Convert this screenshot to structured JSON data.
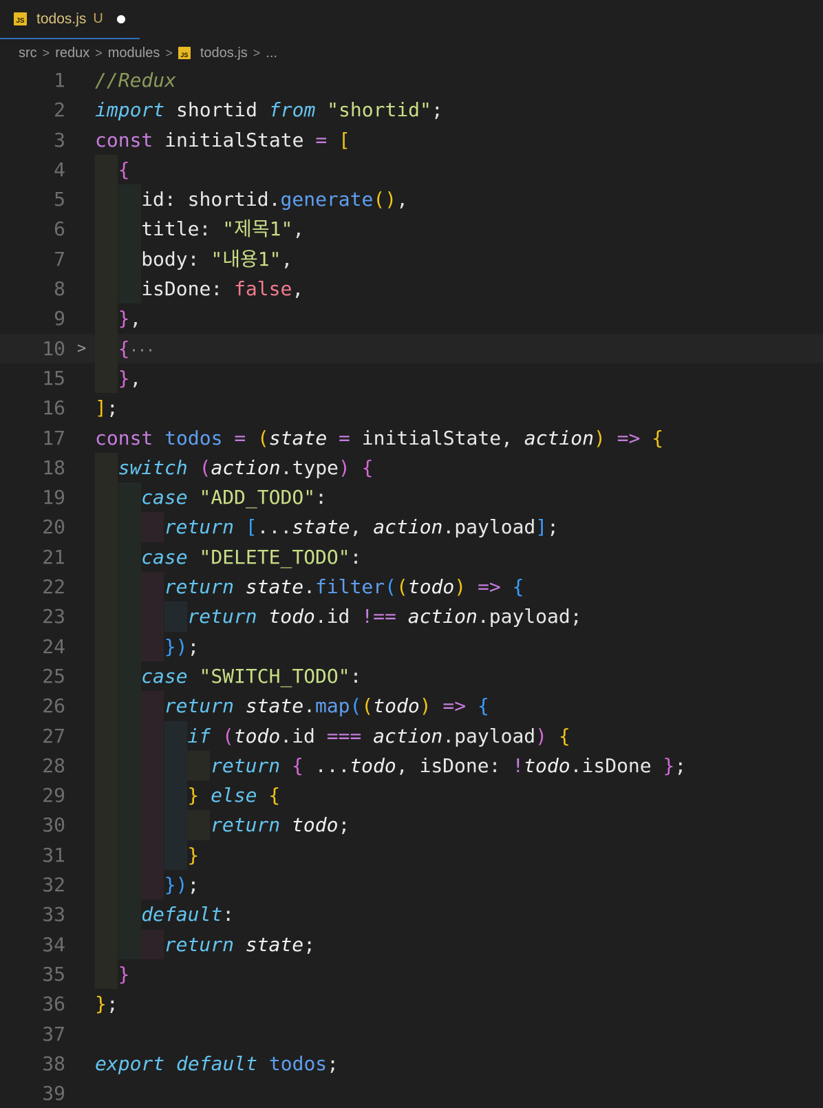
{
  "tab": {
    "icon": "js-file-icon",
    "icon_text": "JS",
    "filename": "todos.js",
    "status": "U"
  },
  "breadcrumb": {
    "parts": [
      "src",
      "redux",
      "modules",
      "todos.js",
      "..."
    ],
    "separator": ">"
  },
  "editor": {
    "lines": [
      {
        "n": "1",
        "indent": [],
        "tokens": [
          [
            "com",
            "//Redux"
          ]
        ]
      },
      {
        "n": "2",
        "indent": [],
        "tokens": [
          [
            "kwi",
            "import"
          ],
          [
            "var",
            " shortid "
          ],
          [
            "kwi",
            "from"
          ],
          [
            "str",
            " \"shortid\""
          ],
          [
            "pun",
            ";"
          ]
        ]
      },
      {
        "n": "3",
        "indent": [],
        "tokens": [
          [
            "kw",
            "const"
          ],
          [
            "var",
            " initialState "
          ],
          [
            "op",
            "="
          ],
          [
            "b1",
            " ["
          ]
        ]
      },
      {
        "n": "4",
        "indent": [
          "gY"
        ],
        "tokens": [
          [
            "b2",
            "{"
          ]
        ]
      },
      {
        "n": "5",
        "indent": [
          "gY",
          "gG"
        ],
        "tokens": [
          [
            "var",
            "id"
          ],
          [
            "pun",
            ": "
          ],
          [
            "var",
            "shortid"
          ],
          [
            "pun",
            "."
          ],
          [
            "fn",
            "generate"
          ],
          [
            "b1",
            "()"
          ],
          [
            "pun",
            ","
          ]
        ]
      },
      {
        "n": "6",
        "indent": [
          "gY",
          "gG"
        ],
        "tokens": [
          [
            "var",
            "title"
          ],
          [
            "pun",
            ": "
          ],
          [
            "str",
            "\"제목1\""
          ],
          [
            "pun",
            ","
          ]
        ]
      },
      {
        "n": "7",
        "indent": [
          "gY",
          "gG"
        ],
        "tokens": [
          [
            "var",
            "body"
          ],
          [
            "pun",
            ": "
          ],
          [
            "str",
            "\"내용1\""
          ],
          [
            "pun",
            ","
          ]
        ]
      },
      {
        "n": "8",
        "indent": [
          "gY",
          "gG"
        ],
        "tokens": [
          [
            "var",
            "isDone"
          ],
          [
            "pun",
            ": "
          ],
          [
            "bool",
            "false"
          ],
          [
            "pun",
            ","
          ]
        ]
      },
      {
        "n": "9",
        "indent": [
          "gY"
        ],
        "tokens": [
          [
            "b2",
            "}"
          ],
          [
            "pun",
            ","
          ]
        ]
      },
      {
        "n": "10",
        "indent": [
          "gY"
        ],
        "fold": ">",
        "highlight": true,
        "tokens": [
          [
            "b2",
            "{"
          ],
          [
            "ell",
            "···"
          ]
        ]
      },
      {
        "n": "15",
        "indent": [
          "gY"
        ],
        "tokens": [
          [
            "b2",
            "}"
          ],
          [
            "pun",
            ","
          ]
        ]
      },
      {
        "n": "16",
        "indent": [],
        "tokens": [
          [
            "b1",
            "]"
          ],
          [
            "pun",
            ";"
          ]
        ]
      },
      {
        "n": "17",
        "indent": [],
        "tokens": [
          [
            "kw",
            "const"
          ],
          [
            "fn",
            " todos "
          ],
          [
            "op",
            "="
          ],
          [
            "b1",
            " ("
          ],
          [
            "param",
            "state"
          ],
          [
            "op",
            " ="
          ],
          [
            "var",
            " initialState"
          ],
          [
            "pun",
            ", "
          ],
          [
            "param",
            "action"
          ],
          [
            "b1",
            ")"
          ],
          [
            "op",
            " =>"
          ],
          [
            "b1",
            " {"
          ]
        ]
      },
      {
        "n": "18",
        "indent": [
          "gY"
        ],
        "tokens": [
          [
            "kwi",
            "switch"
          ],
          [
            "b2",
            " ("
          ],
          [
            "param",
            "action"
          ],
          [
            "pun",
            "."
          ],
          [
            "var",
            "type"
          ],
          [
            "b2",
            ")"
          ],
          [
            "b2",
            " {"
          ]
        ]
      },
      {
        "n": "19",
        "indent": [
          "gY",
          "gG"
        ],
        "tokens": [
          [
            "kwi",
            "case"
          ],
          [
            "str",
            " \"ADD_TODO\""
          ],
          [
            "pun",
            ":"
          ]
        ]
      },
      {
        "n": "20",
        "indent": [
          "gY",
          "gG",
          "gM"
        ],
        "tokens": [
          [
            "kwi",
            "return"
          ],
          [
            "b3",
            " ["
          ],
          [
            "pun",
            "..."
          ],
          [
            "param",
            "state"
          ],
          [
            "pun",
            ", "
          ],
          [
            "param",
            "action"
          ],
          [
            "pun",
            "."
          ],
          [
            "var",
            "payload"
          ],
          [
            "b3",
            "]"
          ],
          [
            "pun",
            ";"
          ]
        ]
      },
      {
        "n": "21",
        "indent": [
          "gY",
          "gG"
        ],
        "tokens": [
          [
            "kwi",
            "case"
          ],
          [
            "str",
            " \"DELETE_TODO\""
          ],
          [
            "pun",
            ":"
          ]
        ]
      },
      {
        "n": "22",
        "indent": [
          "gY",
          "gG",
          "gM"
        ],
        "tokens": [
          [
            "kwi",
            "return"
          ],
          [
            "param",
            " state"
          ],
          [
            "pun",
            "."
          ],
          [
            "fn",
            "filter"
          ],
          [
            "b3",
            "("
          ],
          [
            "b1",
            "("
          ],
          [
            "param",
            "todo"
          ],
          [
            "b1",
            ")"
          ],
          [
            "op",
            " =>"
          ],
          [
            "b3",
            " {"
          ]
        ]
      },
      {
        "n": "23",
        "indent": [
          "gY",
          "gG",
          "gM",
          "gB"
        ],
        "tokens": [
          [
            "kwi",
            "return"
          ],
          [
            "param",
            " todo"
          ],
          [
            "pun",
            "."
          ],
          [
            "var",
            "id"
          ],
          [
            "op",
            " !=="
          ],
          [
            "param",
            " action"
          ],
          [
            "pun",
            "."
          ],
          [
            "var",
            "payload"
          ],
          [
            "pun",
            ";"
          ]
        ]
      },
      {
        "n": "24",
        "indent": [
          "gY",
          "gG",
          "gM"
        ],
        "tokens": [
          [
            "b3",
            "}"
          ],
          [
            "b3",
            ")"
          ],
          [
            "pun",
            ";"
          ]
        ]
      },
      {
        "n": "25",
        "indent": [
          "gY",
          "gG"
        ],
        "tokens": [
          [
            "kwi",
            "case"
          ],
          [
            "str",
            " \"SWITCH_TODO\""
          ],
          [
            "pun",
            ":"
          ]
        ]
      },
      {
        "n": "26",
        "indent": [
          "gY",
          "gG",
          "gM"
        ],
        "tokens": [
          [
            "kwi",
            "return"
          ],
          [
            "param",
            " state"
          ],
          [
            "pun",
            "."
          ],
          [
            "fn",
            "map"
          ],
          [
            "b3",
            "("
          ],
          [
            "b1",
            "("
          ],
          [
            "param",
            "todo"
          ],
          [
            "b1",
            ")"
          ],
          [
            "op",
            " =>"
          ],
          [
            "b3",
            " {"
          ]
        ]
      },
      {
        "n": "27",
        "indent": [
          "gY",
          "gG",
          "gM",
          "gB"
        ],
        "tokens": [
          [
            "kwi",
            "if"
          ],
          [
            "b2",
            " ("
          ],
          [
            "param",
            "todo"
          ],
          [
            "pun",
            "."
          ],
          [
            "var",
            "id"
          ],
          [
            "op",
            " ==="
          ],
          [
            "param",
            " action"
          ],
          [
            "pun",
            "."
          ],
          [
            "var",
            "payload"
          ],
          [
            "b2",
            ")"
          ],
          [
            "b1",
            " {"
          ]
        ]
      },
      {
        "n": "28",
        "indent": [
          "gY",
          "gG",
          "gM",
          "gB",
          "gY"
        ],
        "tokens": [
          [
            "kwi",
            "return"
          ],
          [
            "b2",
            " {"
          ],
          [
            "pun",
            " ..."
          ],
          [
            "param",
            "todo"
          ],
          [
            "pun",
            ", "
          ],
          [
            "var",
            "isDone"
          ],
          [
            "pun",
            ": "
          ],
          [
            "op",
            "!"
          ],
          [
            "param",
            "todo"
          ],
          [
            "pun",
            "."
          ],
          [
            "var",
            "isDone"
          ],
          [
            "b2",
            " }"
          ],
          [
            "pun",
            ";"
          ]
        ]
      },
      {
        "n": "29",
        "indent": [
          "gY",
          "gG",
          "gM",
          "gB"
        ],
        "tokens": [
          [
            "b1",
            "}"
          ],
          [
            "kwi",
            " else"
          ],
          [
            "b1",
            " {"
          ]
        ]
      },
      {
        "n": "30",
        "indent": [
          "gY",
          "gG",
          "gM",
          "gB",
          "gY"
        ],
        "tokens": [
          [
            "kwi",
            "return"
          ],
          [
            "param",
            " todo"
          ],
          [
            "pun",
            ";"
          ]
        ]
      },
      {
        "n": "31",
        "indent": [
          "gY",
          "gG",
          "gM",
          "gB"
        ],
        "tokens": [
          [
            "b1",
            "}"
          ]
        ]
      },
      {
        "n": "32",
        "indent": [
          "gY",
          "gG",
          "gM"
        ],
        "tokens": [
          [
            "b3",
            "}"
          ],
          [
            "b3",
            ")"
          ],
          [
            "pun",
            ";"
          ]
        ]
      },
      {
        "n": "33",
        "indent": [
          "gY",
          "gG"
        ],
        "tokens": [
          [
            "kwi",
            "default"
          ],
          [
            "pun",
            ":"
          ]
        ]
      },
      {
        "n": "34",
        "indent": [
          "gY",
          "gG",
          "gM"
        ],
        "tokens": [
          [
            "kwi",
            "return"
          ],
          [
            "param",
            " state"
          ],
          [
            "pun",
            ";"
          ]
        ]
      },
      {
        "n": "35",
        "indent": [
          "gY"
        ],
        "tokens": [
          [
            "b2",
            "}"
          ]
        ]
      },
      {
        "n": "36",
        "indent": [],
        "tokens": [
          [
            "b1",
            "}"
          ],
          [
            "pun",
            ";"
          ]
        ]
      },
      {
        "n": "37",
        "indent": [],
        "tokens": []
      },
      {
        "n": "38",
        "indent": [],
        "tokens": [
          [
            "kwi",
            "export"
          ],
          [
            "kwi",
            " default"
          ],
          [
            "fn",
            " todos"
          ],
          [
            "pun",
            ";"
          ]
        ]
      },
      {
        "n": "39",
        "indent": [],
        "tokens": []
      }
    ]
  }
}
